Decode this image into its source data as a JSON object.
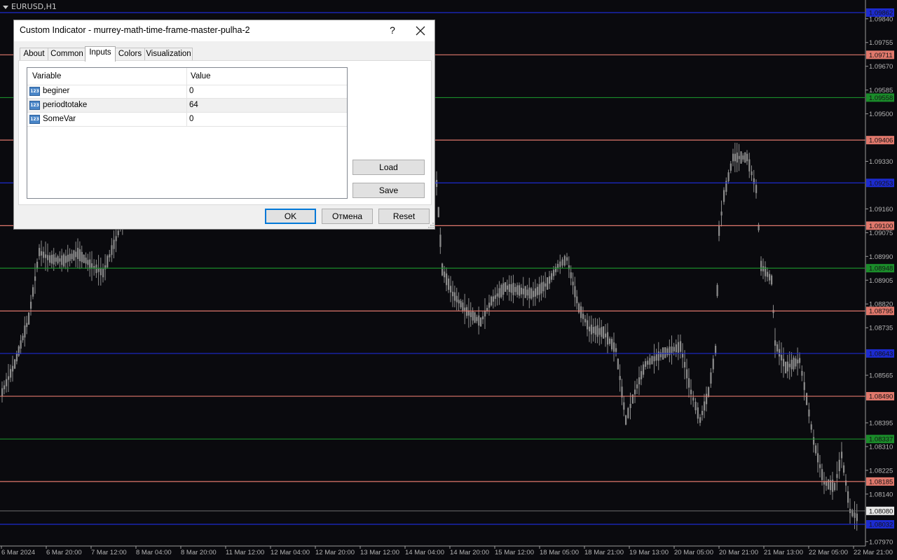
{
  "chart": {
    "symbol": "EURUSD,H1",
    "background": "#0a0a0e",
    "price_labels": [
      "1.09840",
      "1.09755",
      "1.09670",
      "1.09585",
      "1.09500",
      "1.09330",
      "1.09160",
      "1.09075",
      "1.08990",
      "1.08905",
      "1.08820",
      "1.08735",
      "1.08565",
      "1.08395",
      "1.08310",
      "1.08225",
      "1.08140",
      "1.07970"
    ],
    "time_labels": [
      "6 Mar 2024",
      "6 Mar 20:00",
      "7 Mar 12:00",
      "8 Mar 04:00",
      "8 Mar 20:00",
      "11 Mar 12:00",
      "12 Mar 04:00",
      "12 Mar 20:00",
      "13 Mar 12:00",
      "14 Mar 04:00",
      "14 Mar 20:00",
      "15 Mar 12:00",
      "18 Mar 05:00",
      "18 Mar 21:00",
      "19 Mar 13:00",
      "20 Mar 05:00",
      "20 Mar 21:00",
      "21 Mar 13:00",
      "22 Mar 05:00",
      "22 Mar 21:00"
    ],
    "murrey_lines": [
      {
        "label": "1.09862",
        "color": "blue"
      },
      {
        "label": "1.09711",
        "color": "salmon"
      },
      {
        "label": "1.09558",
        "color": "green"
      },
      {
        "label": "1.09406",
        "color": "salmon"
      },
      {
        "label": "1.09253",
        "color": "blue"
      },
      {
        "label": "1.09100",
        "color": "salmon"
      },
      {
        "label": "1.08948",
        "color": "green"
      },
      {
        "label": "1.08795",
        "color": "salmon"
      },
      {
        "label": "1.08643",
        "color": "blue"
      },
      {
        "label": "1.08490",
        "color": "salmon"
      },
      {
        "label": "1.08337",
        "color": "green"
      },
      {
        "label": "1.08185",
        "color": "salmon"
      },
      {
        "label": "1.08032",
        "color": "blue"
      }
    ],
    "current_price": "1.08080",
    "colors": {
      "blue": "#1c2bd0",
      "salmon": "#e0786c",
      "green": "#1a8c2a",
      "candle": "#8c8c8c",
      "axis": "#9a9a9a"
    }
  },
  "dialog": {
    "title": "Custom Indicator - murrey-math-time-frame-master-pulha-2",
    "help": "?",
    "tabs": [
      "About",
      "Common",
      "Inputs",
      "Colors",
      "Visualization"
    ],
    "active_tab": "Inputs",
    "columns": {
      "variable": "Variable",
      "value": "Value"
    },
    "params": [
      {
        "icon": "123",
        "name": "beginer",
        "value": "0"
      },
      {
        "icon": "123",
        "name": "periodtotake",
        "value": "64"
      },
      {
        "icon": "123",
        "name": "SomeVar",
        "value": "0"
      }
    ],
    "buttons": {
      "load": "Load",
      "save": "Save",
      "ok": "OK",
      "cancel": "Отмена",
      "reset": "Reset"
    }
  }
}
